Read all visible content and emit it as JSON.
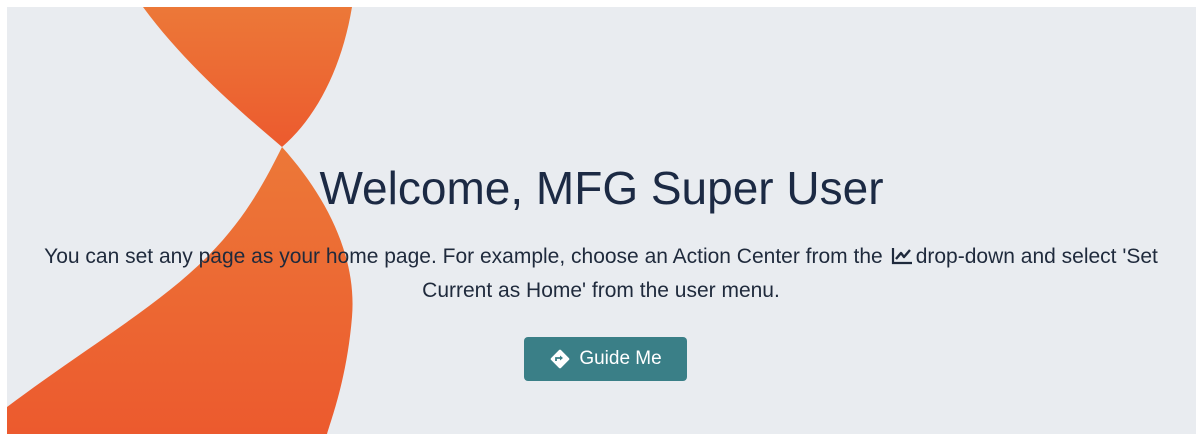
{
  "welcome": {
    "title": "Welcome, MFG Super User",
    "description_part1": "You can set any page as your home page. For example, choose an Action Center from the",
    "description_part2": "drop-down and select 'Set Current as Home' from the user menu.",
    "inline_icon": "line-chart-icon"
  },
  "guide_button": {
    "label": "Guide Me",
    "icon": "directions-icon"
  },
  "colors": {
    "background": "#e9ecf0",
    "accent_orange": "#ec6232",
    "title_text": "#1c2a44",
    "button": "#3a7f87"
  }
}
